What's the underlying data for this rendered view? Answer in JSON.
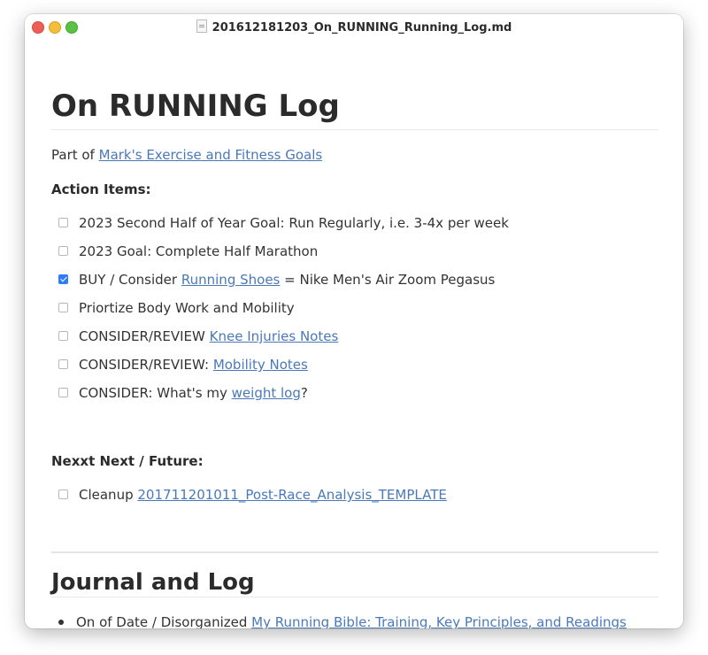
{
  "window": {
    "title": "201612181203_On_RUNNING_Running_Log.md"
  },
  "doc": {
    "h1": "On RUNNING Log",
    "part_of_prefix": "Part of",
    "part_of_link": "Mark's Exercise and Fitness Goals",
    "action_items_heading": "Action Items:",
    "tasks": [
      {
        "checked": false,
        "pre": "2023 Second Half of Year Goal: Run Regularly, i.e. 3-4x per week",
        "link": "",
        "post": ""
      },
      {
        "checked": false,
        "pre": "2023 Goal: Complete Half Marathon",
        "link": "",
        "post": ""
      },
      {
        "checked": true,
        "pre": "BUY / Consider",
        "link": "Running Shoes",
        "post": "= Nike Men's Air Zoom Pegasus"
      },
      {
        "checked": false,
        "pre": "Priortize Body Work and Mobility",
        "link": "",
        "post": ""
      },
      {
        "checked": false,
        "pre": "CONSIDER/REVIEW",
        "link": "Knee Injuries Notes",
        "post": ""
      },
      {
        "checked": false,
        "pre": "CONSIDER/REVIEW:",
        "link": "Mobility Notes",
        "post": ""
      },
      {
        "checked": false,
        "pre": "CONSIDER: What's my",
        "link": "weight log",
        "post": "?"
      }
    ],
    "future_heading": "Nexxt Next / Future:",
    "future_tasks": [
      {
        "checked": false,
        "pre": "Cleanup",
        "link": "201711201011_Post-Race_Analysis_TEMPLATE",
        "post": ""
      }
    ],
    "h2": "Journal and Log",
    "bullets": [
      {
        "pre": "On of Date / Disorganized",
        "link": "My Running Bible: Training, Key Principles, and Readings"
      }
    ]
  }
}
